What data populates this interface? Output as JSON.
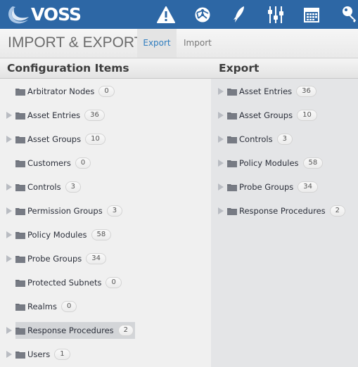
{
  "app": {
    "logo_text": "VOSS",
    "brand_color": "#2d67a5",
    "top_icons": [
      {
        "name": "alert-icon"
      },
      {
        "name": "network-icon"
      },
      {
        "name": "rocket-icon"
      },
      {
        "name": "sliders-icon"
      },
      {
        "name": "calendar-icon"
      },
      {
        "name": "key-icon"
      }
    ]
  },
  "header": {
    "title": "IMPORT & EXPORT",
    "tabs": [
      {
        "label": "Export",
        "active": true
      },
      {
        "label": "Import",
        "active": false
      }
    ]
  },
  "left_panel": {
    "title": "Configuration Items",
    "items": [
      {
        "label": "Arbitrator Nodes",
        "count": "0",
        "expandable": false
      },
      {
        "label": "Asset Entries",
        "count": "36",
        "expandable": true
      },
      {
        "label": "Asset Groups",
        "count": "10",
        "expandable": true
      },
      {
        "label": "Customers",
        "count": "0",
        "expandable": false
      },
      {
        "label": "Controls",
        "count": "3",
        "expandable": true
      },
      {
        "label": "Permission Groups",
        "count": "3",
        "expandable": true
      },
      {
        "label": "Policy Modules",
        "count": "58",
        "expandable": true
      },
      {
        "label": "Probe Groups",
        "count": "34",
        "expandable": true
      },
      {
        "label": "Protected Subnets",
        "count": "0",
        "expandable": false
      },
      {
        "label": "Realms",
        "count": "0",
        "expandable": false
      },
      {
        "label": "Response Procedures",
        "count": "2",
        "expandable": true,
        "selected": true
      },
      {
        "label": "Users",
        "count": "1",
        "expandable": true
      }
    ]
  },
  "right_panel": {
    "title": "Export",
    "items": [
      {
        "label": "Asset Entries",
        "count": "36",
        "expandable": true
      },
      {
        "label": "Asset Groups",
        "count": "10",
        "expandable": true
      },
      {
        "label": "Controls",
        "count": "3",
        "expandable": true
      },
      {
        "label": "Policy Modules",
        "count": "58",
        "expandable": true
      },
      {
        "label": "Probe Groups",
        "count": "34",
        "expandable": true
      },
      {
        "label": "Response Procedures",
        "count": "2",
        "expandable": true
      }
    ]
  }
}
